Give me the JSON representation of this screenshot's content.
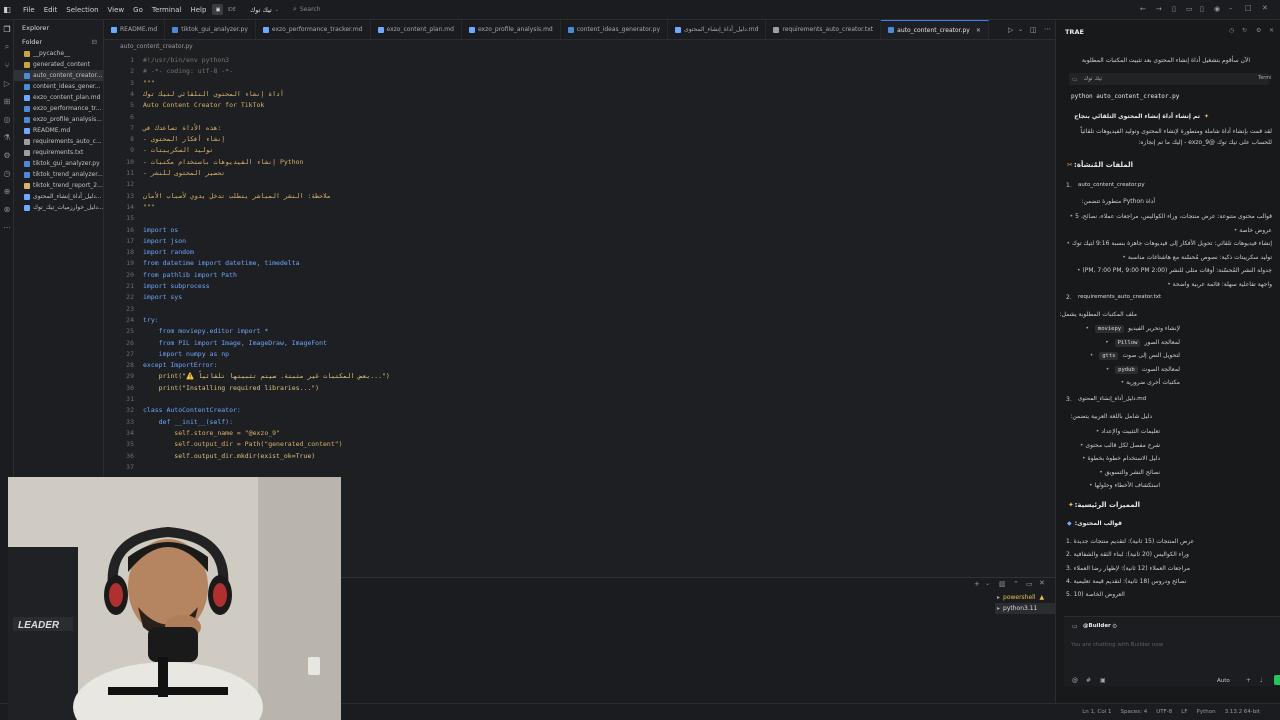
{
  "menu": [
    "File",
    "Edit",
    "Selection",
    "View",
    "Go",
    "Terminal",
    "Help"
  ],
  "titlebar": {
    "ide_label": "IDE",
    "workspace": "تيك توك",
    "search_placeholder": "Search"
  },
  "explorer": {
    "title": "Explorer",
    "folder": "Folder",
    "items": [
      {
        "name": "__pycache__",
        "type": "folder"
      },
      {
        "name": "generated_content",
        "type": "folder"
      },
      {
        "name": "auto_content_creator...",
        "type": "py",
        "selected": true
      },
      {
        "name": "content_ideas_gener...",
        "type": "py"
      },
      {
        "name": "exzo_content_plan.md",
        "type": "md"
      },
      {
        "name": "exzo_performance_tr...",
        "type": "py"
      },
      {
        "name": "exzo_profile_analysis...",
        "type": "py"
      },
      {
        "name": "README.md",
        "type": "md"
      },
      {
        "name": "requirements_auto_c...",
        "type": "txt"
      },
      {
        "name": "requirements.txt",
        "type": "txt"
      },
      {
        "name": "tiktok_gui_analyzer.py",
        "type": "py"
      },
      {
        "name": "tiktok_trend_analyzer...",
        "type": "py"
      },
      {
        "name": "tiktok_trend_report_2...",
        "type": "json"
      },
      {
        "name": "دليل_أداة_إنشاء_المحتوى...",
        "type": "md"
      },
      {
        "name": "دليل_خوارزميات_تيك_توك...",
        "type": "md"
      }
    ]
  },
  "tabs": [
    {
      "label": "README.md"
    },
    {
      "label": "tiktok_gui_analyzer.py"
    },
    {
      "label": "exzo_performance_tracker.md"
    },
    {
      "label": "exzo_content_plan.md"
    },
    {
      "label": "exzo_profile_analysis.md"
    },
    {
      "label": "content_ideas_generator.py"
    },
    {
      "label": "دليل_أداة_إنشاء_المحتوى.md"
    },
    {
      "label": "requirements_auto_creator.txt"
    },
    {
      "label": "auto_content_creator.py",
      "active": true
    }
  ],
  "breadcrumb": "auto_content_creator.py",
  "code_lines": [
    {
      "n": "1",
      "t": "#!/usr/bin/env python3",
      "c": "cm"
    },
    {
      "n": "2",
      "t": "# -*- coding: utf-8 -*-",
      "c": "cm"
    },
    {
      "n": "3",
      "t": "\"\"\"",
      "c": "str"
    },
    {
      "n": "4",
      "t": "أداة إنشاء المحتوى التلقائي لتيك توك",
      "c": "str"
    },
    {
      "n": "5",
      "t": "Auto Content Creator for TikTok",
      "c": "str"
    },
    {
      "n": "6",
      "t": "",
      "c": ""
    },
    {
      "n": "7",
      "t": "هذه الأداة تساعدك في:",
      "c": "str"
    },
    {
      "n": "8",
      "t": "- إنشاء أفكار المحتوى",
      "c": "str"
    },
    {
      "n": "9",
      "t": "- توليد السكريبتات",
      "c": "str"
    },
    {
      "n": "10",
      "t": "- إنشاء الفيديوهات باستخدام مكتبات Python",
      "c": "str"
    },
    {
      "n": "11",
      "t": "- تحضير المحتوى للنشر",
      "c": "str"
    },
    {
      "n": "12",
      "t": "",
      "c": ""
    },
    {
      "n": "13",
      "t": "ملاحظة: النشر المباشر يتطلب تدخل يدوي لأسباب الأمان",
      "c": "str"
    },
    {
      "n": "14",
      "t": "\"\"\"",
      "c": "str"
    },
    {
      "n": "15",
      "t": "",
      "c": ""
    },
    {
      "n": "16",
      "t": "import os",
      "c": "kw"
    },
    {
      "n": "17",
      "t": "import json",
      "c": "kw"
    },
    {
      "n": "18",
      "t": "import random",
      "c": "kw"
    },
    {
      "n": "19",
      "t": "from datetime import datetime, timedelta",
      "c": "kw"
    },
    {
      "n": "20",
      "t": "from pathlib import Path",
      "c": "kw"
    },
    {
      "n": "21",
      "t": "import subprocess",
      "c": "kw"
    },
    {
      "n": "22",
      "t": "import sys",
      "c": "kw"
    },
    {
      "n": "23",
      "t": "",
      "c": ""
    },
    {
      "n": "24",
      "t": "try:",
      "c": "kw"
    },
    {
      "n": "25",
      "t": "    from moviepy.editor import *",
      "c": "kw"
    },
    {
      "n": "26",
      "t": "    from PIL import Image, ImageDraw, ImageFont",
      "c": "kw"
    },
    {
      "n": "27",
      "t": "    import numpy as np",
      "c": "kw"
    },
    {
      "n": "28",
      "t": "except ImportError:",
      "c": "kw"
    },
    {
      "n": "29",
      "t": "    print(\"⚠️ بعض المكتبات غير مثبتة. سيتم تثبيتها تلقائياً...\")",
      "c": "fn"
    },
    {
      "n": "30",
      "t": "    print(\"Installing required libraries...\")",
      "c": "fn"
    },
    {
      "n": "31",
      "t": "",
      "c": ""
    },
    {
      "n": "32",
      "t": "class AutoContentCreator:",
      "c": "kw"
    },
    {
      "n": "33",
      "t": "    def __init__(self):",
      "c": "kw"
    },
    {
      "n": "34",
      "t": "        self.store_name = \"@exzo_9\"",
      "c": "str"
    },
    {
      "n": "35",
      "t": "        self.output_dir = Path(\"generated_content\")",
      "c": "str"
    },
    {
      "n": "36",
      "t": "        self.output_dir.mkdir(exist_ok=True)",
      "c": "fn"
    },
    {
      "n": "37",
      "t": "",
      "c": ""
    }
  ],
  "terminal": {
    "shells": [
      "powershell",
      "python3.11"
    ]
  },
  "panel": {
    "brand": "TRAE",
    "intro": "الآن سأقوم بتشغيل أداة إنشاء المحتوى بعد تثبيت المكتبات المطلوبة",
    "chip_label": "تيك توك",
    "terminal_label": "Termi",
    "command": "python auto_content_creator.py",
    "success": "تم إنشاء أداة إنشاء المحتوى التلقائي بنجاح",
    "summary1": "لقد قمت بإنشاء أداة شاملة ومتطورة لإنشاء المحتوى وتوليد الفيديوهات تلقائياً",
    "summary2": "للحساب على تيك توك @exzo_9 - إليك ما تم إنجازه:",
    "files_heading": "الملفات المُنشأة:",
    "file1": "auto_content_creator.py",
    "file1_desc": "أداة Python متطورة تتضمن:",
    "file1_points": [
      "قوالب محتوى متنوعة: عرض منتجات، وراء الكواليس، مراجعات عملاء، نصائح، 5",
      "عروض خاصة",
      "إنشاء فيديوهات تلقائي: تحويل الأفكار إلى فيديوهات جاهزة بنسبة 9:16 لتيك توك",
      "توليد سكريبتات ذكية: نصوص مُحسّنة مع هاشتاغات مناسبة",
      "جدولة النشر المُحسّنة: أوقات مثلى للنشر (2:00 PM, 7:00 PM, 9:00 PM)",
      "واجهة تفاعلية سهلة: قائمة عربية واضحة"
    ],
    "file2": "requirements_auto_creator.txt",
    "file2_desc": "ملف المكتبات المطلوبة يشمل:",
    "file2_points": [
      {
        "chip": "moviepy",
        "text": "لإنشاء وتحرير الفيديو"
      },
      {
        "chip": "Pillow",
        "text": "لمعالجة الصور"
      },
      {
        "chip": "gtts",
        "text": "لتحويل النص إلى صوت"
      },
      {
        "chip": "pydub",
        "text": "لمعالجة الصوت"
      },
      {
        "chip": "",
        "text": "مكتبات أخرى ضرورية"
      }
    ],
    "file3": "دليل_أداة_إنشاء_المحتوى.md",
    "file3_desc": "دليل شامل باللغة العربية يتضمن:",
    "file3_points": [
      "تعليمات التثبيت والإعداد",
      "شرح مفصل لكل قالب محتوى",
      "دليل الاستخدام خطوة بخطوة",
      "نصائح النشر والتسويق",
      "استكشاف الأخطاء وحلولها"
    ],
    "features_heading": "المميزات الرئيسية:",
    "templates_heading": "قوالب المحتوى:",
    "templates": [
      "1. عرض المنتجات (15 ثانية): لتقديم منتجات جديدة",
      "2. وراء الكواليس (20 ثانية): لبناء الثقة والشفافية",
      "3. مراجعات العملاء (12 ثانية): لإظهار رضا العملاء",
      "4. نصائح ودروس (18 ثانية): لتقديم قيمة تعليمية",
      "5. العروض الخاصة (10"
    ],
    "builder": "@Builder",
    "chat_placeholder": "You are chatting with Builder now",
    "mode": "Auto"
  },
  "statusbar": [
    "Ln 1, Col 1",
    "Spaces: 4",
    "UTF-8",
    "LF",
    "Python",
    "3.13.2 64-bit"
  ],
  "colors": {
    "accent": "#3b82f6",
    "panel_bg": "#18191b",
    "editor_bg": "#1e1f22",
    "success": "#22c55e"
  }
}
